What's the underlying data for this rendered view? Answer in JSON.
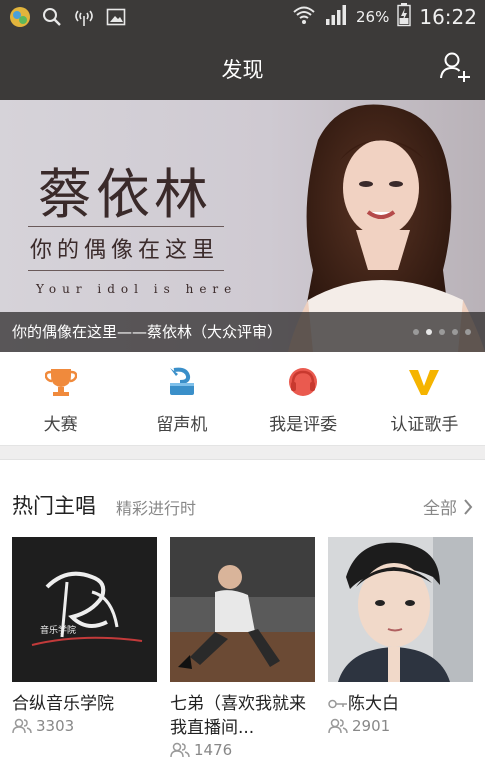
{
  "status_bar": {
    "battery_percent": "26%",
    "time": "16:22"
  },
  "app_bar": {
    "title": "发现"
  },
  "banner": {
    "artist_name": "蔡依林",
    "slogan": "你的偶像在这里",
    "slogan_en": "Your idol is here",
    "caption": "你的偶像在这里——蔡依林（大众评审）",
    "dot_count": 5,
    "active_dot": 1
  },
  "categories": [
    {
      "label": "大赛",
      "icon": "trophy-icon",
      "color": "#f08a3c"
    },
    {
      "label": "留声机",
      "icon": "gramophone-icon",
      "color": "#3a8fc9"
    },
    {
      "label": "我是评委",
      "icon": "headphones-icon",
      "color": "#ea5a4f"
    },
    {
      "label": "认证歌手",
      "icon": "verified-v-icon",
      "color": "#f5b400"
    }
  ],
  "hot": {
    "title": "热门主唱",
    "subtitle": "精彩进行时",
    "more": "全部",
    "cards": [
      {
        "name": "合纵音乐学院",
        "count": "3303",
        "img_text": "音乐学院"
      },
      {
        "name": "七弟（喜欢我就来我直播间...",
        "count": "1476"
      },
      {
        "name": "陈大白",
        "count": "2901"
      }
    ]
  },
  "colors": {
    "bar_bg": "#3c3a39",
    "accent_orange": "#f08a3c"
  }
}
